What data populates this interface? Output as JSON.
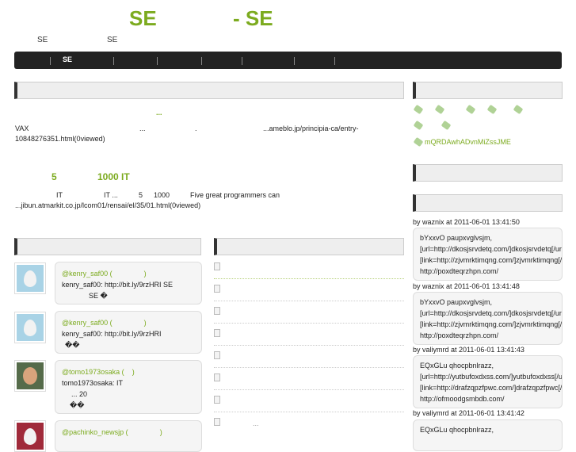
{
  "header": {
    "title_left": "SE",
    "title_right": "- SE",
    "subtitle": [
      "SE",
      "SE"
    ]
  },
  "nav": {
    "items": [
      "SE"
    ]
  },
  "posts": [
    {
      "title": "...",
      "excerpt": [
        "VAX",
        "...",
        ".",
        "...ameblo.jp/principia-ca/entry-",
        "10848276351.html(0viewed)"
      ]
    },
    {
      "title": [
        "5",
        "1000  IT"
      ],
      "excerpt": [
        "IT",
        "IT ...",
        "5",
        "1000",
        "Five great programmers can",
        "...jibun.atmarkit.co.jp/lcom01/rensai/el/35/01.html(0viewed)"
      ]
    }
  ],
  "tweets": [
    {
      "user": "@kenry_saf00 (",
      "close": ")",
      "lines": [
        "kenry_saf00: http://bit.ly/9rzHRI        SE",
        "SE            �"
      ]
    },
    {
      "user": "@kenry_saf00 (",
      "close": ")",
      "lines": [
        "kenry_saf00: http://bit.ly/9rzHRI",
        "��"
      ]
    },
    {
      "user": "@tomo1973osaka (",
      "close": ")",
      "lines": [
        "tomo1973osaka:                         IT",
        "...                              20",
        "��"
      ]
    },
    {
      "user": "@pachinko_newsjp (",
      "close": ")",
      "lines": []
    }
  ],
  "related": {
    "last_item": "..."
  },
  "tags": {
    "link": "mQRDAwhADvnMiZssJME"
  },
  "comments": [
    {
      "meta": "by waznix at 2011-06-01 13:41:50",
      "lines": [
        "bYxxvO paupxvglvsjm,",
        "[url=http://dkosjsrvdetq.com/]dkosjsrvdetq[/url],",
        "[link=http://zjvmrktimqng.com/]zjvmrktimqng[/link],",
        "http://poxdteqrzhpn.com/"
      ]
    },
    {
      "meta": "by waznix at 2011-06-01 13:41:48",
      "lines": [
        "bYxxvO paupxvglvsjm,",
        "[url=http://dkosjsrvdetq.com/]dkosjsrvdetq[/url],",
        "[link=http://zjvmrktimqng.com/]zjvmrktimqng[/link],",
        "http://poxdteqrzhpn.com/"
      ]
    },
    {
      "meta": "by valiymrd at 2011-06-01 13:41:43",
      "lines": [
        "EQxGLu qhocpbnlrazz,",
        "[url=http://yutbufoxdxss.com/]yutbufoxdxss[/url],",
        "[link=http://drafzqpzfpwc.com/]drafzqpzfpwc[/link],",
        "http://ofmoodgsmbdb.com/"
      ]
    },
    {
      "meta": "by valiymrd at 2011-06-01 13:41:42",
      "lines": [
        "EQxGLu qhocpbnlrazz,"
      ]
    }
  ],
  "colors": {
    "accent": "#7cab1f",
    "nav": "#222222"
  }
}
